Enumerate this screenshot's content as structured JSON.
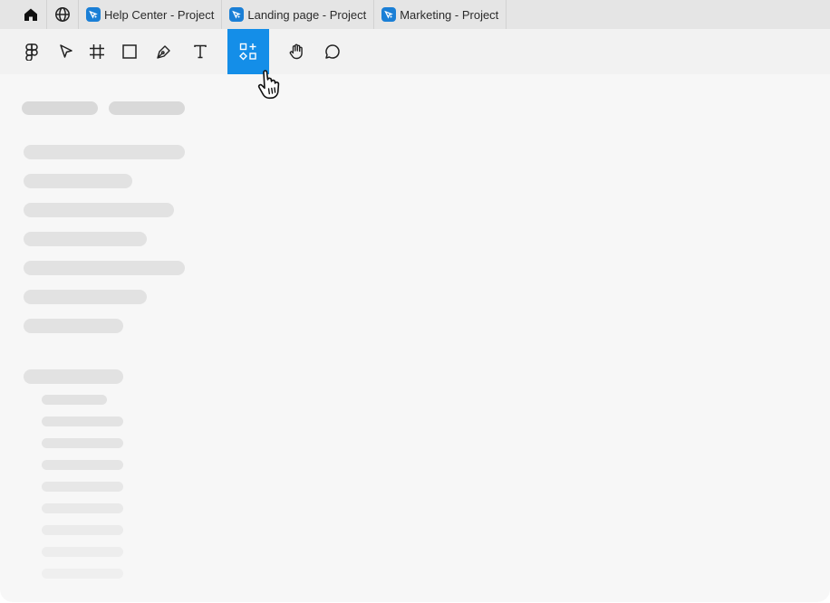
{
  "tabs": [
    {
      "label": "Help Center - Project"
    },
    {
      "label": "Landing page - Project"
    },
    {
      "label": "Marketing - Project"
    }
  ],
  "icons": {
    "home": "home-icon",
    "globe": "globe-icon",
    "favicon": "project-favicon-icon",
    "logo": "figma-logo-icon",
    "move": "move-tool-icon",
    "frame": "frame-tool-icon",
    "shape": "rectangle-tool-icon",
    "pen": "pen-tool-icon",
    "text": "text-tool-icon",
    "resources": "resources-icon",
    "hand": "hand-tool-icon",
    "comment": "comment-tool-icon",
    "cursor": "pointer-hand-cursor-icon"
  },
  "colors": {
    "accent": "#148ee8",
    "favicon": "#1a7fd6",
    "tabbar": "#e5e5e5",
    "toolbar": "#f2f2f2",
    "canvas": "#f7f7f7",
    "skeleton": "#e0e0e0"
  }
}
